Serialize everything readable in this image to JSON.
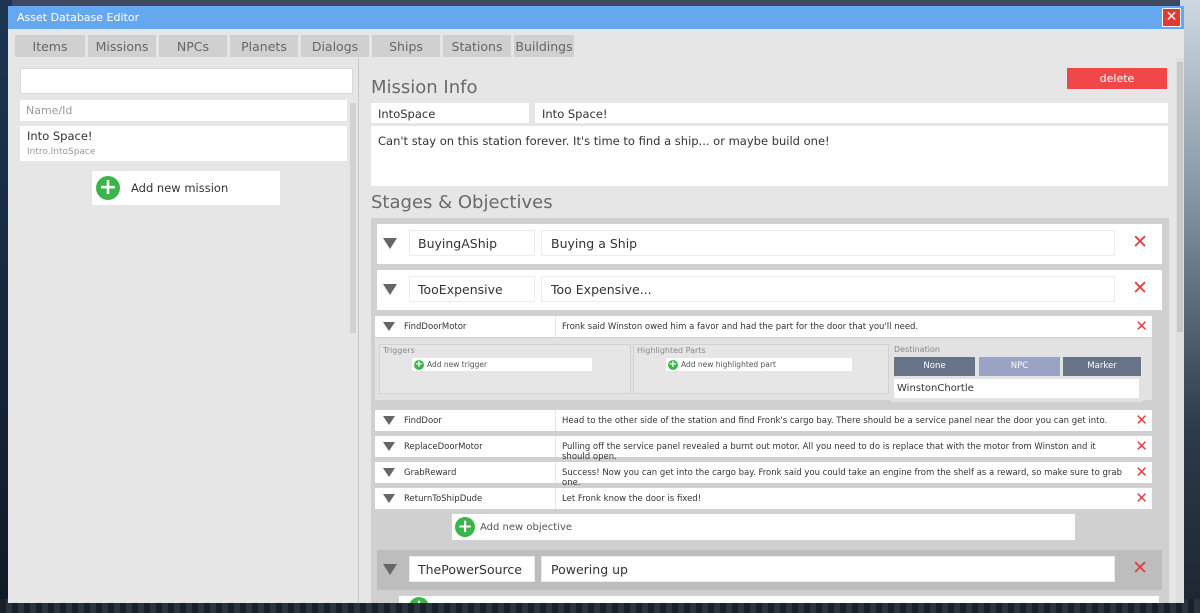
{
  "window": {
    "title": "Asset Database Editor",
    "close_label": "✕"
  },
  "tabs": [
    {
      "label": "Items"
    },
    {
      "label": "Missions"
    },
    {
      "label": "NPCs"
    },
    {
      "label": "Planets"
    },
    {
      "label": "Dialogs"
    },
    {
      "label": "Ships"
    },
    {
      "label": "Stations"
    },
    {
      "label": "Buildings"
    }
  ],
  "sidebar": {
    "search_value": "",
    "filter_placeholder": "Name/Id",
    "missions": [
      {
        "name": "Into Space!",
        "id": "Intro.IntoSpace"
      }
    ],
    "add_label": "Add new mission"
  },
  "mission_info": {
    "title": "Mission Info",
    "delete_label": "delete",
    "id": "IntoSpace",
    "name": "Into Space!",
    "description": "Can't stay on this station forever. It's time to find a ship... or maybe build one!"
  },
  "stages_section": {
    "title": "Stages & Objectives",
    "stages": [
      {
        "id": "BuyingAShip",
        "name": "Buying a Ship"
      },
      {
        "id": "TooExpensive",
        "name": "Too Expensive...",
        "objectives": [
          {
            "id": "FindDoorMotor",
            "text": "Fronk said Winston owed him a favor and had the part for the door that you'll need."
          },
          {
            "id": "FindDoor",
            "text": "Head to the other side of the station and find Fronk's cargo bay. There should be a service panel near the door you can get into."
          },
          {
            "id": "ReplaceDoorMotor",
            "text": "Pulling off the service panel revealed a burnt out motor. All you need to do is replace that with the motor from Winston and it should open."
          },
          {
            "id": "GrabReward",
            "text": "Success! Now you can get into the cargo bay. Fronk said you could take an engine from the shelf as a reward, so make sure to grab one."
          },
          {
            "id": "ReturnToShipDude",
            "text": "Let Fronk know the door is fixed!"
          }
        ],
        "detail": {
          "triggers_label": "Triggers",
          "add_trigger_label": "Add new trigger",
          "highlighted_label": "Highlighted Parts",
          "add_highlighted_label": "Add new highlighted part",
          "destination_label": "Destination",
          "destination_options": [
            "None",
            "NPC",
            "Marker"
          ],
          "destination_selected": "NPC",
          "destination_value": "WinstonChortle"
        },
        "add_objective_label": "Add new objective"
      },
      {
        "id": "ThePowerSource",
        "name": "Powering up"
      }
    ]
  },
  "icons": {
    "add": "plus-circle-icon",
    "remove": "x-icon",
    "expand": "triangle-down-icon",
    "close": "close-icon"
  },
  "colors": {
    "titlebar": "#66a8f0",
    "delete": "#f04848",
    "add": "#3ab54a",
    "remove": "#e04040",
    "destination_button": "#667389",
    "destination_selected": "#9aa3c4"
  }
}
